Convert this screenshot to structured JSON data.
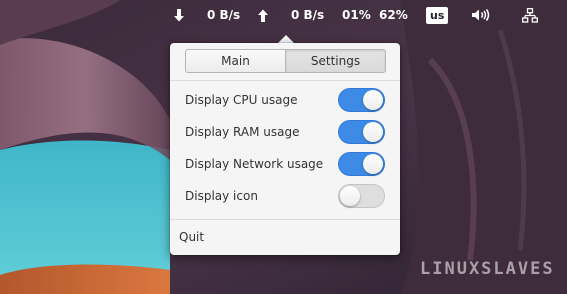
{
  "panel": {
    "download_icon": "arrow-down-icon",
    "download_speed": "0 B/s",
    "upload_icon": "arrow-up-icon",
    "upload_speed": "0 B/s",
    "cpu_usage": "01%",
    "ram_usage": "62%",
    "keyboard_layout": "us",
    "volume_icon": "speaker-volume-icon",
    "network_icon": "network-wired-icon"
  },
  "popover": {
    "tabs": [
      {
        "label": "Main",
        "active": false
      },
      {
        "label": "Settings",
        "active": true
      }
    ],
    "settings": [
      {
        "label": "Display CPU usage",
        "enabled": true
      },
      {
        "label": "Display RAM usage",
        "enabled": true
      },
      {
        "label": "Display Network usage",
        "enabled": true
      },
      {
        "label": "Display icon",
        "enabled": false
      }
    ],
    "quit_label": "Quit"
  },
  "watermark": "LINUXSLAVES",
  "colors": {
    "toggle_on": "#3d8be6",
    "toggle_off": "#dedede",
    "popover_bg": "#f5f5f5"
  }
}
